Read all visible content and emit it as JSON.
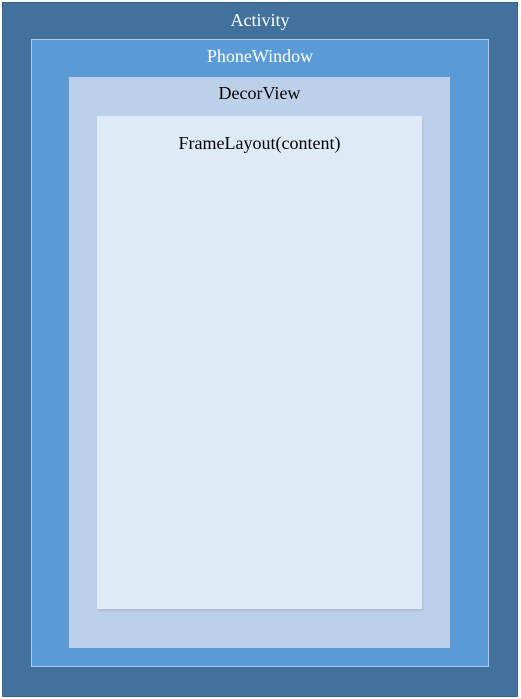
{
  "diagram": {
    "layers": [
      {
        "id": "activity",
        "label": "Activity",
        "fill": "#41719c",
        "text_color": "#ffffff"
      },
      {
        "id": "phone-window",
        "label": "PhoneWindow",
        "fill": "#5b9bd5",
        "text_color": "#ffffff"
      },
      {
        "id": "decor-view",
        "label": "DecorView",
        "fill": "#bdd0e9",
        "text_color": "#000000"
      },
      {
        "id": "frame-layout",
        "label": "FrameLayout(content)",
        "fill": "#deeaf6",
        "text_color": "#000000"
      }
    ]
  }
}
